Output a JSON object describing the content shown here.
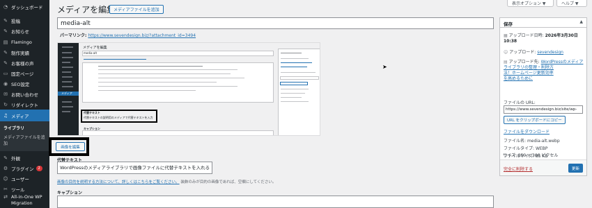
{
  "sidebar": {
    "items": [
      {
        "icon": "gauge-icon",
        "glyph": "◔",
        "label": "ダッシュボード"
      },
      {
        "icon": "pin-icon",
        "glyph": "✎",
        "label": "投稿"
      },
      {
        "icon": "pin-icon",
        "glyph": "✎",
        "label": "お知らせ"
      },
      {
        "icon": "flamingo-icon",
        "glyph": "▤",
        "label": "Flamingo"
      },
      {
        "icon": "pin-icon",
        "glyph": "✎",
        "label": "制作実績"
      },
      {
        "icon": "pin-icon",
        "glyph": "✎",
        "label": "お客様の声"
      },
      {
        "icon": "page-icon",
        "glyph": "▭",
        "label": "固定ページ"
      },
      {
        "icon": "seo-icon",
        "glyph": "◉",
        "label": "SEO設定"
      },
      {
        "icon": "mail-icon",
        "glyph": "✉",
        "label": "お問い合わせ"
      },
      {
        "icon": "redirect-icon",
        "glyph": "↻",
        "label": "リダイレクト"
      },
      {
        "icon": "media-icon",
        "glyph": "♫",
        "label": "メディア"
      }
    ],
    "submenu": {
      "library": "ライブラリ",
      "add_new_line1": "メディアファイルを追",
      "add_new_line2": "加"
    },
    "items_bottom": [
      {
        "icon": "appearance-icon",
        "glyph": "✎",
        "label": "外観"
      },
      {
        "icon": "plugin-icon",
        "glyph": "⚙",
        "label": "プラグイン",
        "badge": "2"
      },
      {
        "icon": "user-icon",
        "glyph": "☺",
        "label": "ユーザー"
      },
      {
        "icon": "tool-icon",
        "glyph": "✂",
        "label": "ツール"
      },
      {
        "icon": "migration-icon",
        "glyph": "⇄",
        "label": "All-in-One WP",
        "label2": "Migration"
      }
    ]
  },
  "screen_meta": {
    "options": "表示オプション ▼",
    "help": "ヘルプ ▼"
  },
  "header": {
    "title": "メディアを編集",
    "add_media_button": "メディアファイルを追加"
  },
  "title_field": {
    "value": "media-alt"
  },
  "permalink": {
    "label": "パーマリンク:",
    "url": "https://www.sevendesign.biz/?attachment_id=3494"
  },
  "preview_texts": {
    "title": "メディアを編集",
    "field": "media-alt",
    "sidebar_highlight": "メディア",
    "alt_label": "代替テキスト",
    "alt_value": "代替テキストの説明用のメディアで代替テキストを入力",
    "caption": "キャプション"
  },
  "edit_image_button": "画像を編集",
  "alt_text": {
    "label": "代替テキスト",
    "value": "WordPressのメディアライブラリで画像ファイルに代替テキストを入れる",
    "desc_link": "画像の目的を説明する方法について、詳しくはこちらをご覧ください。",
    "desc_rest": "装飾のみが目的の画像であれば、空欄にしてください。"
  },
  "caption": {
    "label": "キャプション"
  },
  "save_panel": {
    "title": "保存",
    "toggle": "▲",
    "uploaded_on_label": "アップロード日時:",
    "uploaded_on_value": "2026年3月30日",
    "uploaded_time": "10:38",
    "uploaded_by_label": "アップロード:",
    "uploaded_by_value": "sevendesign",
    "uploaded_to_label": "アップロード先:",
    "uploaded_to_line1": "WordPressのメディア",
    "uploaded_to_line2": "ライブラリの整理・削除方",
    "uploaded_to_line3": "法！ホームページ更新効率",
    "uploaded_to_line4": "を高めるために",
    "file_url_label": "ファイルの URL:",
    "file_url_value": "https://www.sevendesign.biz/site/wp-",
    "copy_button": "URL をクリップボードにコピー",
    "download_link": "ファイルをダウンロード",
    "file_name_label": "ファイル名:",
    "file_name_value": "media-alt.webp",
    "file_type_label": "ファイルタイプ:",
    "file_type_value": "WEBP",
    "file_size_label": "ファイルサイズ:",
    "file_size_value": "85 KB",
    "dimensions_label": "サイズ:",
    "dimensions_value": "850 × 300 ピクセル",
    "delete_link": "完全に削除する",
    "update_button": "更新"
  }
}
